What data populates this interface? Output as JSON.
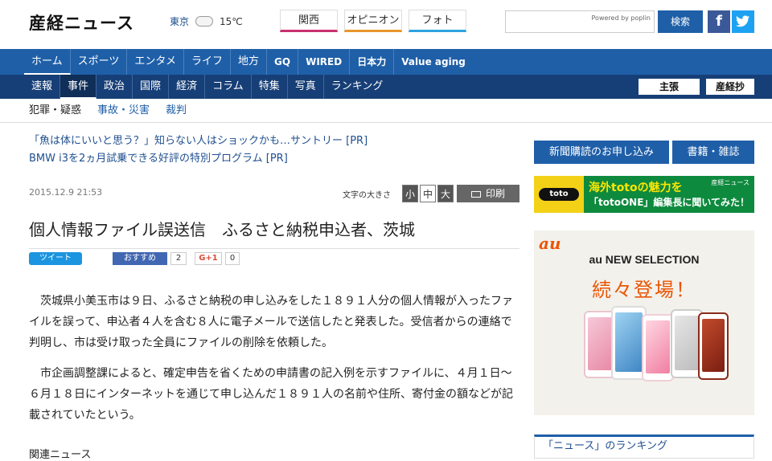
{
  "header": {
    "logo": "産経ニュース",
    "weather_city": "東京",
    "weather_temp": "15℃",
    "tabs": [
      "関西",
      "オピニオン",
      "フォト"
    ],
    "search_placeholder": "",
    "search_powered": "Powered by poplin",
    "search_button": "検索",
    "facebook_icon": "f",
    "twitter_icon": "t"
  },
  "nav_primary": [
    "ホーム",
    "スポーツ",
    "エンタメ",
    "ライフ",
    "地方",
    "GQ",
    "WIRED",
    "日本力",
    "Value aging"
  ],
  "nav_secondary": [
    "速報",
    "事件",
    "政治",
    "国際",
    "経済",
    "コラム",
    "特集",
    "写真",
    "ランキング"
  ],
  "nav_secondary_ads": [
    "主張",
    "産経抄"
  ],
  "nav_tertiary": [
    "犯罪・疑惑",
    "事故・災害",
    "裁判"
  ],
  "pr_links": [
    "「魚は体にいいと思う？」知らない人はショックかも…サントリー [PR]",
    "BMW i3を2ヵ月試乗できる好評の特別プログラム [PR]"
  ],
  "article": {
    "date": "2015.12.9 21:53",
    "font_size_label": "文字の大きさ",
    "font_small": "小",
    "font_medium": "中",
    "font_large": "大",
    "print": "印刷",
    "title": "個人情報ファイル誤送信　ふるさと納税申込者、茨城",
    "tweet": "ツイート",
    "fb_recommend": "おすすめ",
    "fb_count": "2",
    "gplus": "G+1",
    "gplus_count": "0",
    "paragraphs": [
      "茨城県小美玉市は９日、ふるさと納税の申し込みをした１８９１人分の個人情報が入ったファイルを誤って、申込者４人を含む８人に電子メールで送信したと発表した。受信者からの連絡で判明し、市は受け取った全員にファイルの削除を依頼した。",
      "市企画調整課によると、確定申告を省くための申請書の記入例を示すファイルに、４月１日～６月１８日にインターネットを通じて申し込んだ１８９１人の名前や住所、寄付金の額などが記載されていたという。"
    ],
    "related": "関連ニュース"
  },
  "sidebar": {
    "subscribe": "新聞購読のお申し込み",
    "books": "書籍・雑誌",
    "toto_badge": "toto",
    "toto_line1": "海外totoの魅力を",
    "toto_line2": "「totoONE」編集長に聞いてみた！",
    "toto_brand": "産経ニュース",
    "au_logo": "au",
    "au_selection": "au NEW SELECTION",
    "au_coming": "続々登場！",
    "ranking_title": "「ニュース」のランキング"
  }
}
